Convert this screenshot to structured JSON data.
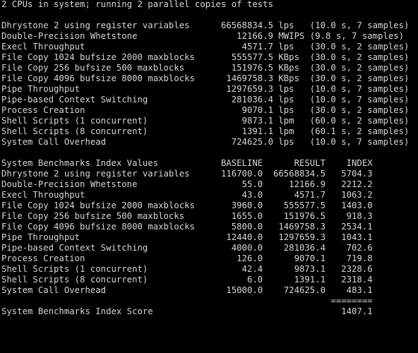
{
  "terminal": {
    "background_color": "#000000",
    "text_color": "#d6d6d6",
    "columns": 80,
    "header_line": "2 CPUs in system; running 2 parallel copies of tests"
  },
  "benchmark_results": {
    "name_column_width": 40,
    "value_column_end": 53,
    "unit_column_start": 54,
    "timing_column_start": 60,
    "rows": [
      {
        "name": "Dhrystone 2 using register variables",
        "value": "66568834.5",
        "unit": "lps",
        "timing": "(10.0 s, 7 samples)"
      },
      {
        "name": "Double-Precision Whetstone",
        "value": "12166.9",
        "unit": "MWIPS",
        "timing": "(9.8 s, 7 samples)"
      },
      {
        "name": "Execl Throughput",
        "value": "4571.7",
        "unit": "lps",
        "timing": "(30.0 s, 2 samples)"
      },
      {
        "name": "File Copy 1024 bufsize 2000 maxblocks",
        "value": "555577.5",
        "unit": "KBps",
        "timing": "(30.0 s, 2 samples)"
      },
      {
        "name": "File Copy 256 bufsize 500 maxblocks",
        "value": "151976.5",
        "unit": "KBps",
        "timing": "(30.0 s, 2 samples)"
      },
      {
        "name": "File Copy 4096 bufsize 8000 maxblocks",
        "value": "1469758.3",
        "unit": "KBps",
        "timing": "(30.0 s, 2 samples)"
      },
      {
        "name": "Pipe Throughput",
        "value": "1297659.3",
        "unit": "lps",
        "timing": "(10.0 s, 7 samples)"
      },
      {
        "name": "Pipe-based Context Switching",
        "value": "281036.4",
        "unit": "lps",
        "timing": "(10.0 s, 7 samples)"
      },
      {
        "name": "Process Creation",
        "value": "9070.1",
        "unit": "lps",
        "timing": "(30.0 s, 2 samples)"
      },
      {
        "name": "Shell Scripts (1 concurrent)",
        "value": "9873.1",
        "unit": "lpm",
        "timing": "(60.0 s, 2 samples)"
      },
      {
        "name": "Shell Scripts (8 concurrent)",
        "value": "1391.1",
        "unit": "lpm",
        "timing": "(60.1 s, 2 samples)"
      },
      {
        "name": "System Call Overhead",
        "value": "724625.0",
        "unit": "lps",
        "timing": "(10.0 s, 7 samples)"
      }
    ]
  },
  "index_values": {
    "title": "System Benchmarks Index Values",
    "headers": {
      "baseline": "BASELINE",
      "result": "RESULT",
      "index": "INDEX"
    },
    "rows": [
      {
        "name": "Dhrystone 2 using register variables",
        "baseline": "116700.0",
        "result": "66568834.5",
        "index": "5704.3"
      },
      {
        "name": "Double-Precision Whetstone",
        "baseline": "55.0",
        "result": "12166.9",
        "index": "2212.2"
      },
      {
        "name": "Execl Throughput",
        "baseline": "43.0",
        "result": "4571.7",
        "index": "1063.2"
      },
      {
        "name": "File Copy 1024 bufsize 2000 maxblocks",
        "baseline": "3960.0",
        "result": "555577.5",
        "index": "1403.0"
      },
      {
        "name": "File Copy 256 bufsize 500 maxblocks",
        "baseline": "1655.0",
        "result": "151976.5",
        "index": "918.3"
      },
      {
        "name": "File Copy 4096 bufsize 8000 maxblocks",
        "baseline": "5800.0",
        "result": "1469758.3",
        "index": "2534.1"
      },
      {
        "name": "Pipe Throughput",
        "baseline": "12440.0",
        "result": "1297659.3",
        "index": "1043.1"
      },
      {
        "name": "Pipe-based Context Switching",
        "baseline": "4000.0",
        "result": "281036.4",
        "index": "702.6"
      },
      {
        "name": "Process Creation",
        "baseline": "126.0",
        "result": "9070.1",
        "index": "719.8"
      },
      {
        "name": "Shell Scripts (1 concurrent)",
        "baseline": "42.4",
        "result": "9873.1",
        "index": "2328.6"
      },
      {
        "name": "Shell Scripts (8 concurrent)",
        "baseline": "6.0",
        "result": "1391.1",
        "index": "2318.4"
      },
      {
        "name": "System Call Overhead",
        "baseline": "15000.0",
        "result": "724625.0",
        "index": "483.1"
      }
    ],
    "separator": "========",
    "score_label": "System Benchmarks Index Score",
    "score_value": "1407.1"
  }
}
